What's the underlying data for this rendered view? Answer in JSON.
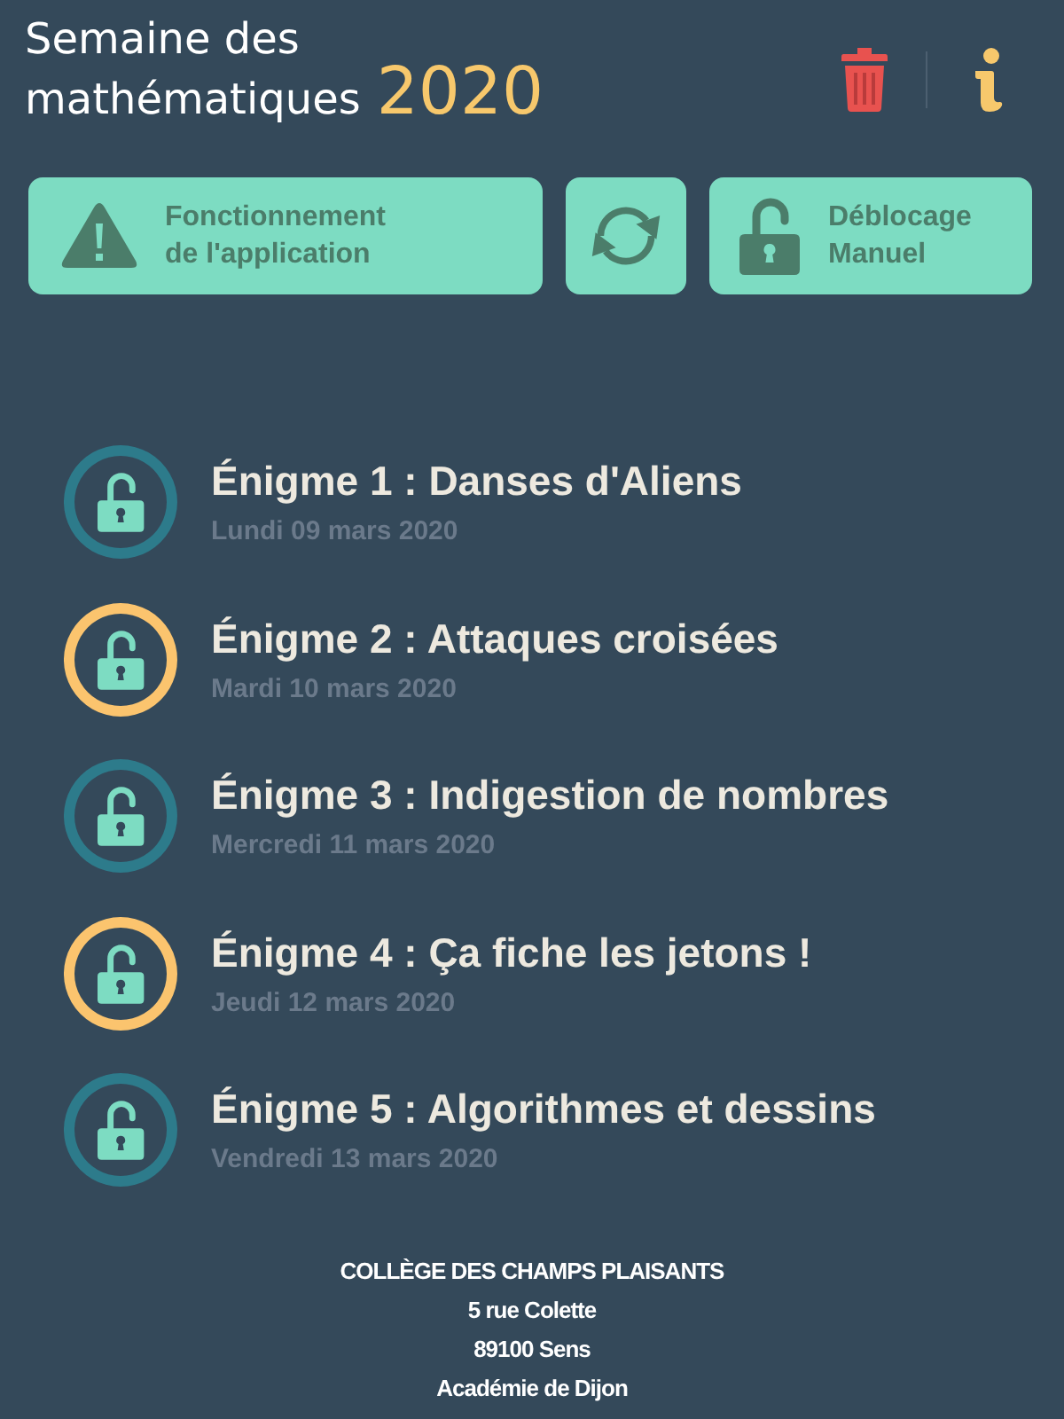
{
  "header": {
    "title": "Semaine des\nmathématiques",
    "year": "2020"
  },
  "actions": [
    {
      "kind": "guide",
      "label": "Fonctionnement\nde l'application"
    },
    {
      "kind": "refresh"
    },
    {
      "kind": "unlock",
      "label": "Déblocage\nManuel"
    }
  ],
  "puzzles": [
    {
      "title": "Énigme 1 : Danses d'Aliens",
      "date": "Lundi 09 mars 2020",
      "color": "#2d7b8b"
    },
    {
      "title": "Énigme 2 : Attaques croisées",
      "date": "Mardi 10 mars 2020",
      "color": "#fbc46e"
    },
    {
      "title": "Énigme 3 : Indigestion de nombres",
      "date": "Mercredi 11 mars 2020",
      "color": "#2d7b8b"
    },
    {
      "title": "Énigme 4 : Ça fiche les jetons !",
      "date": "Jeudi 12 mars 2020",
      "color": "#fbc46e"
    },
    {
      "title": "Énigme 5 : Algorithmes et dessins",
      "date": "Vendredi 13 mars 2020",
      "color": "#2d7b8b"
    }
  ],
  "footer": [
    "COLLÈGE DES CHAMPS PLAISANTS",
    "5 rue Colette",
    "89100 Sens",
    "Académie de Dijon"
  ]
}
